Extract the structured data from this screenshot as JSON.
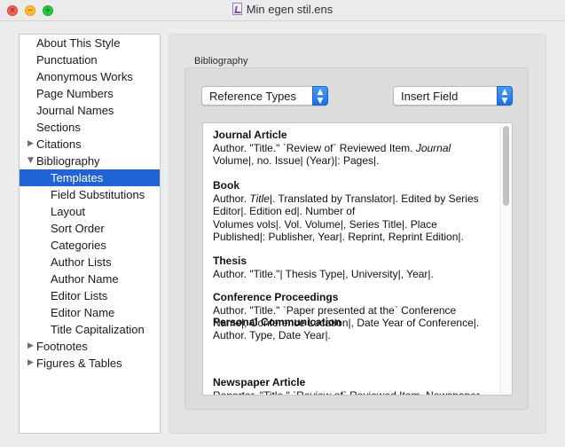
{
  "window": {
    "title": "Min egen stil.ens",
    "buttons": {
      "close": "×",
      "minimize": "−",
      "zoom": "+"
    }
  },
  "sidebar": {
    "items": [
      {
        "label": "About This Style"
      },
      {
        "label": "Punctuation"
      },
      {
        "label": "Anonymous Works"
      },
      {
        "label": "Page Numbers"
      },
      {
        "label": "Journal Names"
      },
      {
        "label": "Sections"
      },
      {
        "label": "Citations",
        "disclosure": "▶"
      },
      {
        "label": "Bibliography",
        "disclosure": "▼"
      },
      {
        "label": "Templates",
        "selected": true
      },
      {
        "label": "Field Substitutions"
      },
      {
        "label": "Layout"
      },
      {
        "label": "Sort Order"
      },
      {
        "label": "Categories"
      },
      {
        "label": "Author Lists"
      },
      {
        "label": "Author Name"
      },
      {
        "label": "Editor Lists"
      },
      {
        "label": "Editor Name"
      },
      {
        "label": "Title Capitalization"
      },
      {
        "label": "Footnotes",
        "disclosure": "▶"
      },
      {
        "label": "Figures & Tables",
        "disclosure": "▶"
      }
    ],
    "selected_color": "#1f63d6"
  },
  "main": {
    "group_label": "Bibliography",
    "reference_types_popup": "Reference Types",
    "insert_field_popup": "Insert Field",
    "popup_arrow_up": "▲",
    "popup_arrow_down": "▼",
    "entries": [
      {
        "title": "Journal Article",
        "lines": [
          "Author. \"Title.\" `Review of` Reviewed Item. <i>Journal</i>",
          "Volume|, no. Issue| (Year)|: Pages|."
        ]
      },
      {
        "title": "Book",
        "lines": [
          "Author. <i>Title</i>|. Translated by Translator|. Edited by Series",
          "Editor|. Edition ed|. Number of",
          "Volumes vols|. Vol. Volume|, Series Title|. Place",
          "Published|: Publisher, Year|. Reprint, Reprint Edition|."
        ]
      },
      {
        "title": "Thesis",
        "lines": [
          "Author. \"Title.\"| Thesis Type|, University|, Year|."
        ]
      },
      {
        "title": "Conference Proceedings",
        "lines": [
          "Author. \"Title.\" `Paper presented at the` Conference",
          "Name|, Conference Location|, Date Year of Conference|."
        ]
      },
      {
        "title": "Personal Communication",
        "lines": [
          "Author. Type, Date Year|."
        ]
      },
      {
        "title": "Newspaper Article",
        "lines": [
          "Reporter. \"Title.\" `Review of` Reviewed Item. Newspaper"
        ]
      }
    ]
  }
}
